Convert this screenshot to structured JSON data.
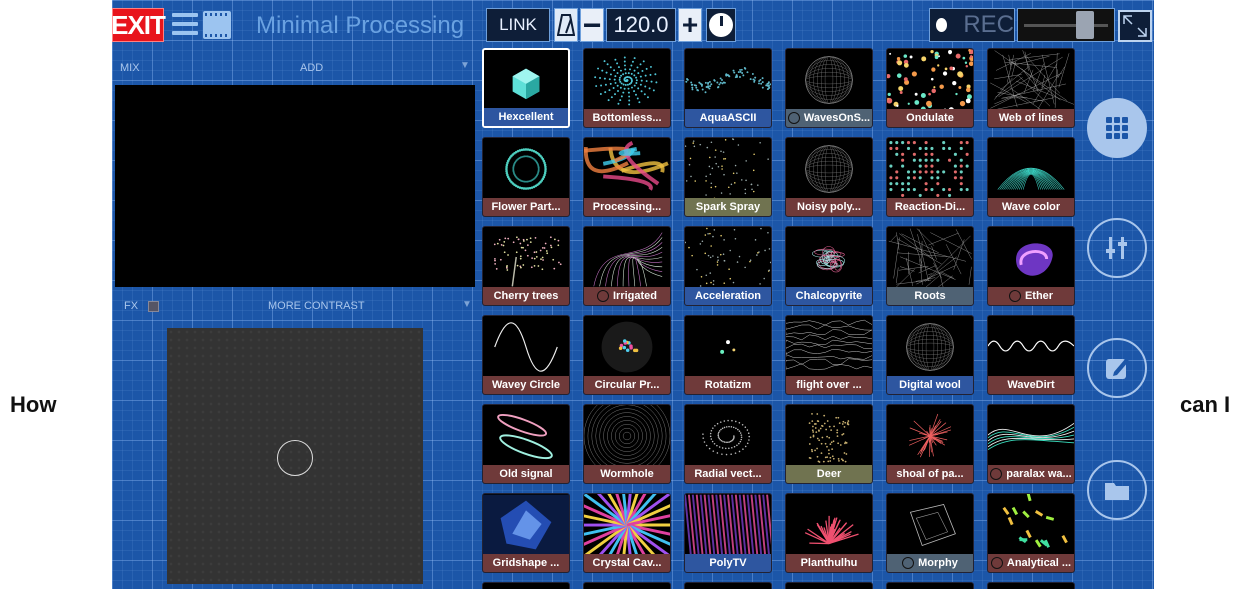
{
  "outer": {
    "left_text": "How",
    "right_text": "can I"
  },
  "toolbar": {
    "exit_label": "EXIT",
    "title": "Minimal Processing",
    "link_label": "LINK",
    "minus_label": "−",
    "bpm": "120.0",
    "plus_label": "+",
    "rec_label": "REC"
  },
  "left_panel": {
    "mix_label": "MIX",
    "add_label": "ADD",
    "fx_label": "FX",
    "contrast_label": "MORE CONTRAST",
    "dropdown_arrow": "▼"
  },
  "grid": {
    "tiles": [
      {
        "label": "Hexcellent",
        "style": "blue",
        "ring": false,
        "thumb": "cube"
      },
      {
        "label": "Bottomless...",
        "style": "red",
        "ring": false,
        "thumb": "spiral"
      },
      {
        "label": "AquaASCII",
        "style": "blue",
        "ring": false,
        "thumb": "wave"
      },
      {
        "label": "WavesOnS...",
        "style": "slate",
        "ring": true,
        "thumb": "sphere"
      },
      {
        "label": "Ondulate",
        "style": "red",
        "ring": false,
        "thumb": "dots"
      },
      {
        "label": "Web of lines",
        "style": "red",
        "ring": false,
        "thumb": "web"
      },
      {
        "label": "Flower Part...",
        "style": "red",
        "ring": false,
        "thumb": "ring"
      },
      {
        "label": "Processing...",
        "style": "red",
        "ring": false,
        "thumb": "ribbons"
      },
      {
        "label": "Spark Spray",
        "style": "olive",
        "ring": false,
        "thumb": "sparks"
      },
      {
        "label": "Noisy poly...",
        "style": "red",
        "ring": false,
        "thumb": "sphere"
      },
      {
        "label": "Reaction-Di...",
        "style": "red",
        "ring": false,
        "thumb": "pattern"
      },
      {
        "label": "Wave color",
        "style": "red",
        "ring": false,
        "thumb": "mesh"
      },
      {
        "label": "Cherry trees",
        "style": "red",
        "ring": false,
        "thumb": "tree"
      },
      {
        "label": "Irrigated",
        "style": "red",
        "ring": true,
        "thumb": "lines"
      },
      {
        "label": "Acceleration",
        "style": "blue",
        "ring": false,
        "thumb": "sparks"
      },
      {
        "label": "Chalcopyrite",
        "style": "blue",
        "ring": false,
        "thumb": "blob"
      },
      {
        "label": "Roots",
        "style": "slate",
        "ring": false,
        "thumb": "web"
      },
      {
        "label": "Ether",
        "style": "red",
        "ring": true,
        "thumb": "ether"
      },
      {
        "label": "Wavey Circle",
        "style": "red",
        "ring": false,
        "thumb": "sine"
      },
      {
        "label": "Circular Pr...",
        "style": "red",
        "ring": false,
        "thumb": "circle"
      },
      {
        "label": "Rotatizm",
        "style": "red",
        "ring": false,
        "thumb": "few"
      },
      {
        "label": "flight over ...",
        "style": "red",
        "ring": false,
        "thumb": "terrain"
      },
      {
        "label": "Digital wool",
        "style": "blue",
        "ring": false,
        "thumb": "sphere"
      },
      {
        "label": "WaveDirt",
        "style": "red",
        "ring": false,
        "thumb": "squiggle"
      },
      {
        "label": "Old signal",
        "style": "red",
        "ring": false,
        "thumb": "ellipses"
      },
      {
        "label": "Wormhole",
        "style": "red",
        "ring": false,
        "thumb": "tunnel"
      },
      {
        "label": "Radial vect...",
        "style": "red",
        "ring": false,
        "thumb": "swirl"
      },
      {
        "label": "Deer",
        "style": "olive",
        "ring": false,
        "thumb": "deer"
      },
      {
        "label": "shoal of pa...",
        "style": "red",
        "ring": false,
        "thumb": "burst"
      },
      {
        "label": "paralax wa...",
        "style": "red",
        "ring": true,
        "thumb": "waves"
      },
      {
        "label": "Gridshape ...",
        "style": "red",
        "ring": false,
        "thumb": "crystal"
      },
      {
        "label": "Crystal Cav...",
        "style": "red",
        "ring": false,
        "thumb": "rays"
      },
      {
        "label": "PolyTV",
        "style": "blue",
        "ring": false,
        "thumb": "stripes"
      },
      {
        "label": "Planthulhu",
        "style": "red",
        "ring": false,
        "thumb": "plant"
      },
      {
        "label": "Morphy",
        "style": "slate",
        "ring": true,
        "thumb": "cube3d"
      },
      {
        "label": "Analytical ...",
        "style": "red",
        "ring": true,
        "thumb": "confetti"
      }
    ]
  },
  "right_nav": {
    "items": [
      {
        "name": "grid-view-icon",
        "active": true
      },
      {
        "name": "sliders-icon",
        "active": false
      },
      {
        "name": "edit-icon",
        "active": false
      },
      {
        "name": "folder-icon",
        "active": false
      }
    ]
  },
  "colors": {
    "background": "#1c56a8",
    "exit": "#e8141c",
    "caption_red": "#6f3a3a",
    "caption_blue": "#2e56a0"
  }
}
